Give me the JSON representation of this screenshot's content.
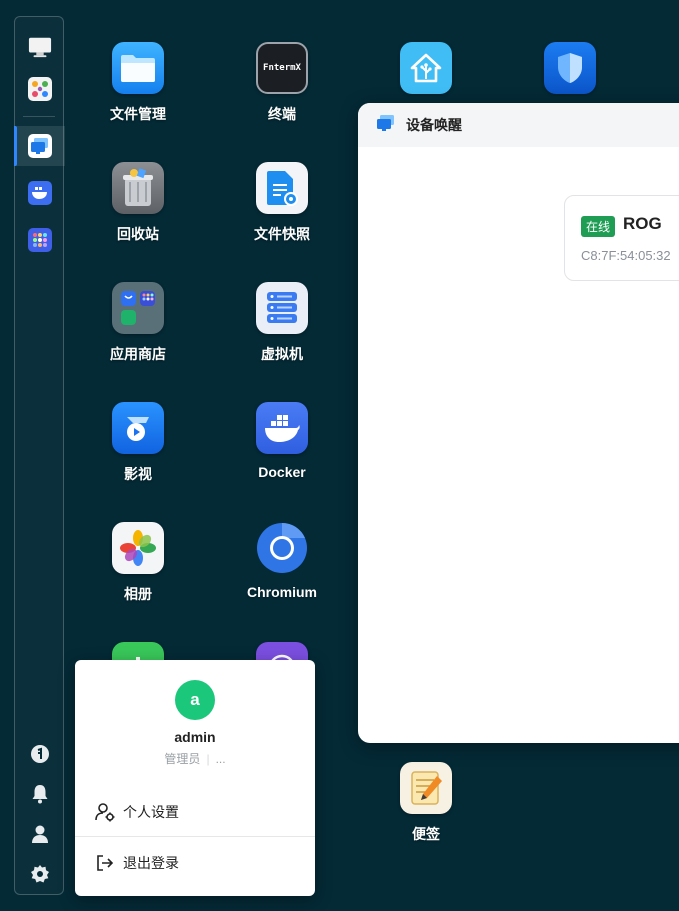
{
  "dock": {
    "items": [
      {
        "name": "monitor-icon"
      },
      {
        "name": "app-grid-colorful-icon"
      },
      {
        "name": "device-wake-icon"
      },
      {
        "name": "docker-icon"
      },
      {
        "name": "app-store-icon"
      },
      {
        "name": "one-panel-icon"
      },
      {
        "name": "bell-icon"
      },
      {
        "name": "user-icon"
      },
      {
        "name": "gear-icon"
      }
    ]
  },
  "apps": [
    {
      "label": "文件管理",
      "icon": "folder-icon"
    },
    {
      "label": "终端",
      "icon": "terminal-icon",
      "icon_text": "FntermX"
    },
    {
      "label": "",
      "icon": "home-assistant-icon"
    },
    {
      "label": "",
      "icon": "shield-icon"
    },
    {
      "label": "回收站",
      "icon": "trash-icon"
    },
    {
      "label": "文件快照",
      "icon": "file-snapshot-icon"
    },
    {
      "label": "应用商店",
      "icon": "app-store-icon"
    },
    {
      "label": "虚拟机",
      "icon": "virtual-machine-icon"
    },
    {
      "label": "影视",
      "icon": "video-icon"
    },
    {
      "label": "Docker",
      "icon": "docker-icon"
    },
    {
      "label": "相册",
      "icon": "photos-icon"
    },
    {
      "label": "Chromium",
      "icon": "chromium-icon"
    },
    {
      "label": "便签",
      "icon": "notes-icon"
    }
  ],
  "window": {
    "title": "设备唤醒",
    "device": {
      "status": "在线",
      "name": "ROG",
      "mac": "C8:7F:54:05:32"
    }
  },
  "user_menu": {
    "avatar_letter": "a",
    "username": "admin",
    "role": "管理员",
    "more": "...",
    "items": [
      {
        "label": "个人设置",
        "icon": "user-settings-icon"
      },
      {
        "label": "退出登录",
        "icon": "logout-icon"
      }
    ]
  },
  "colors": {
    "background": "#042a36",
    "accent": "#2f86ff",
    "online": "#1f9d55",
    "avatar": "#1bc77a"
  }
}
